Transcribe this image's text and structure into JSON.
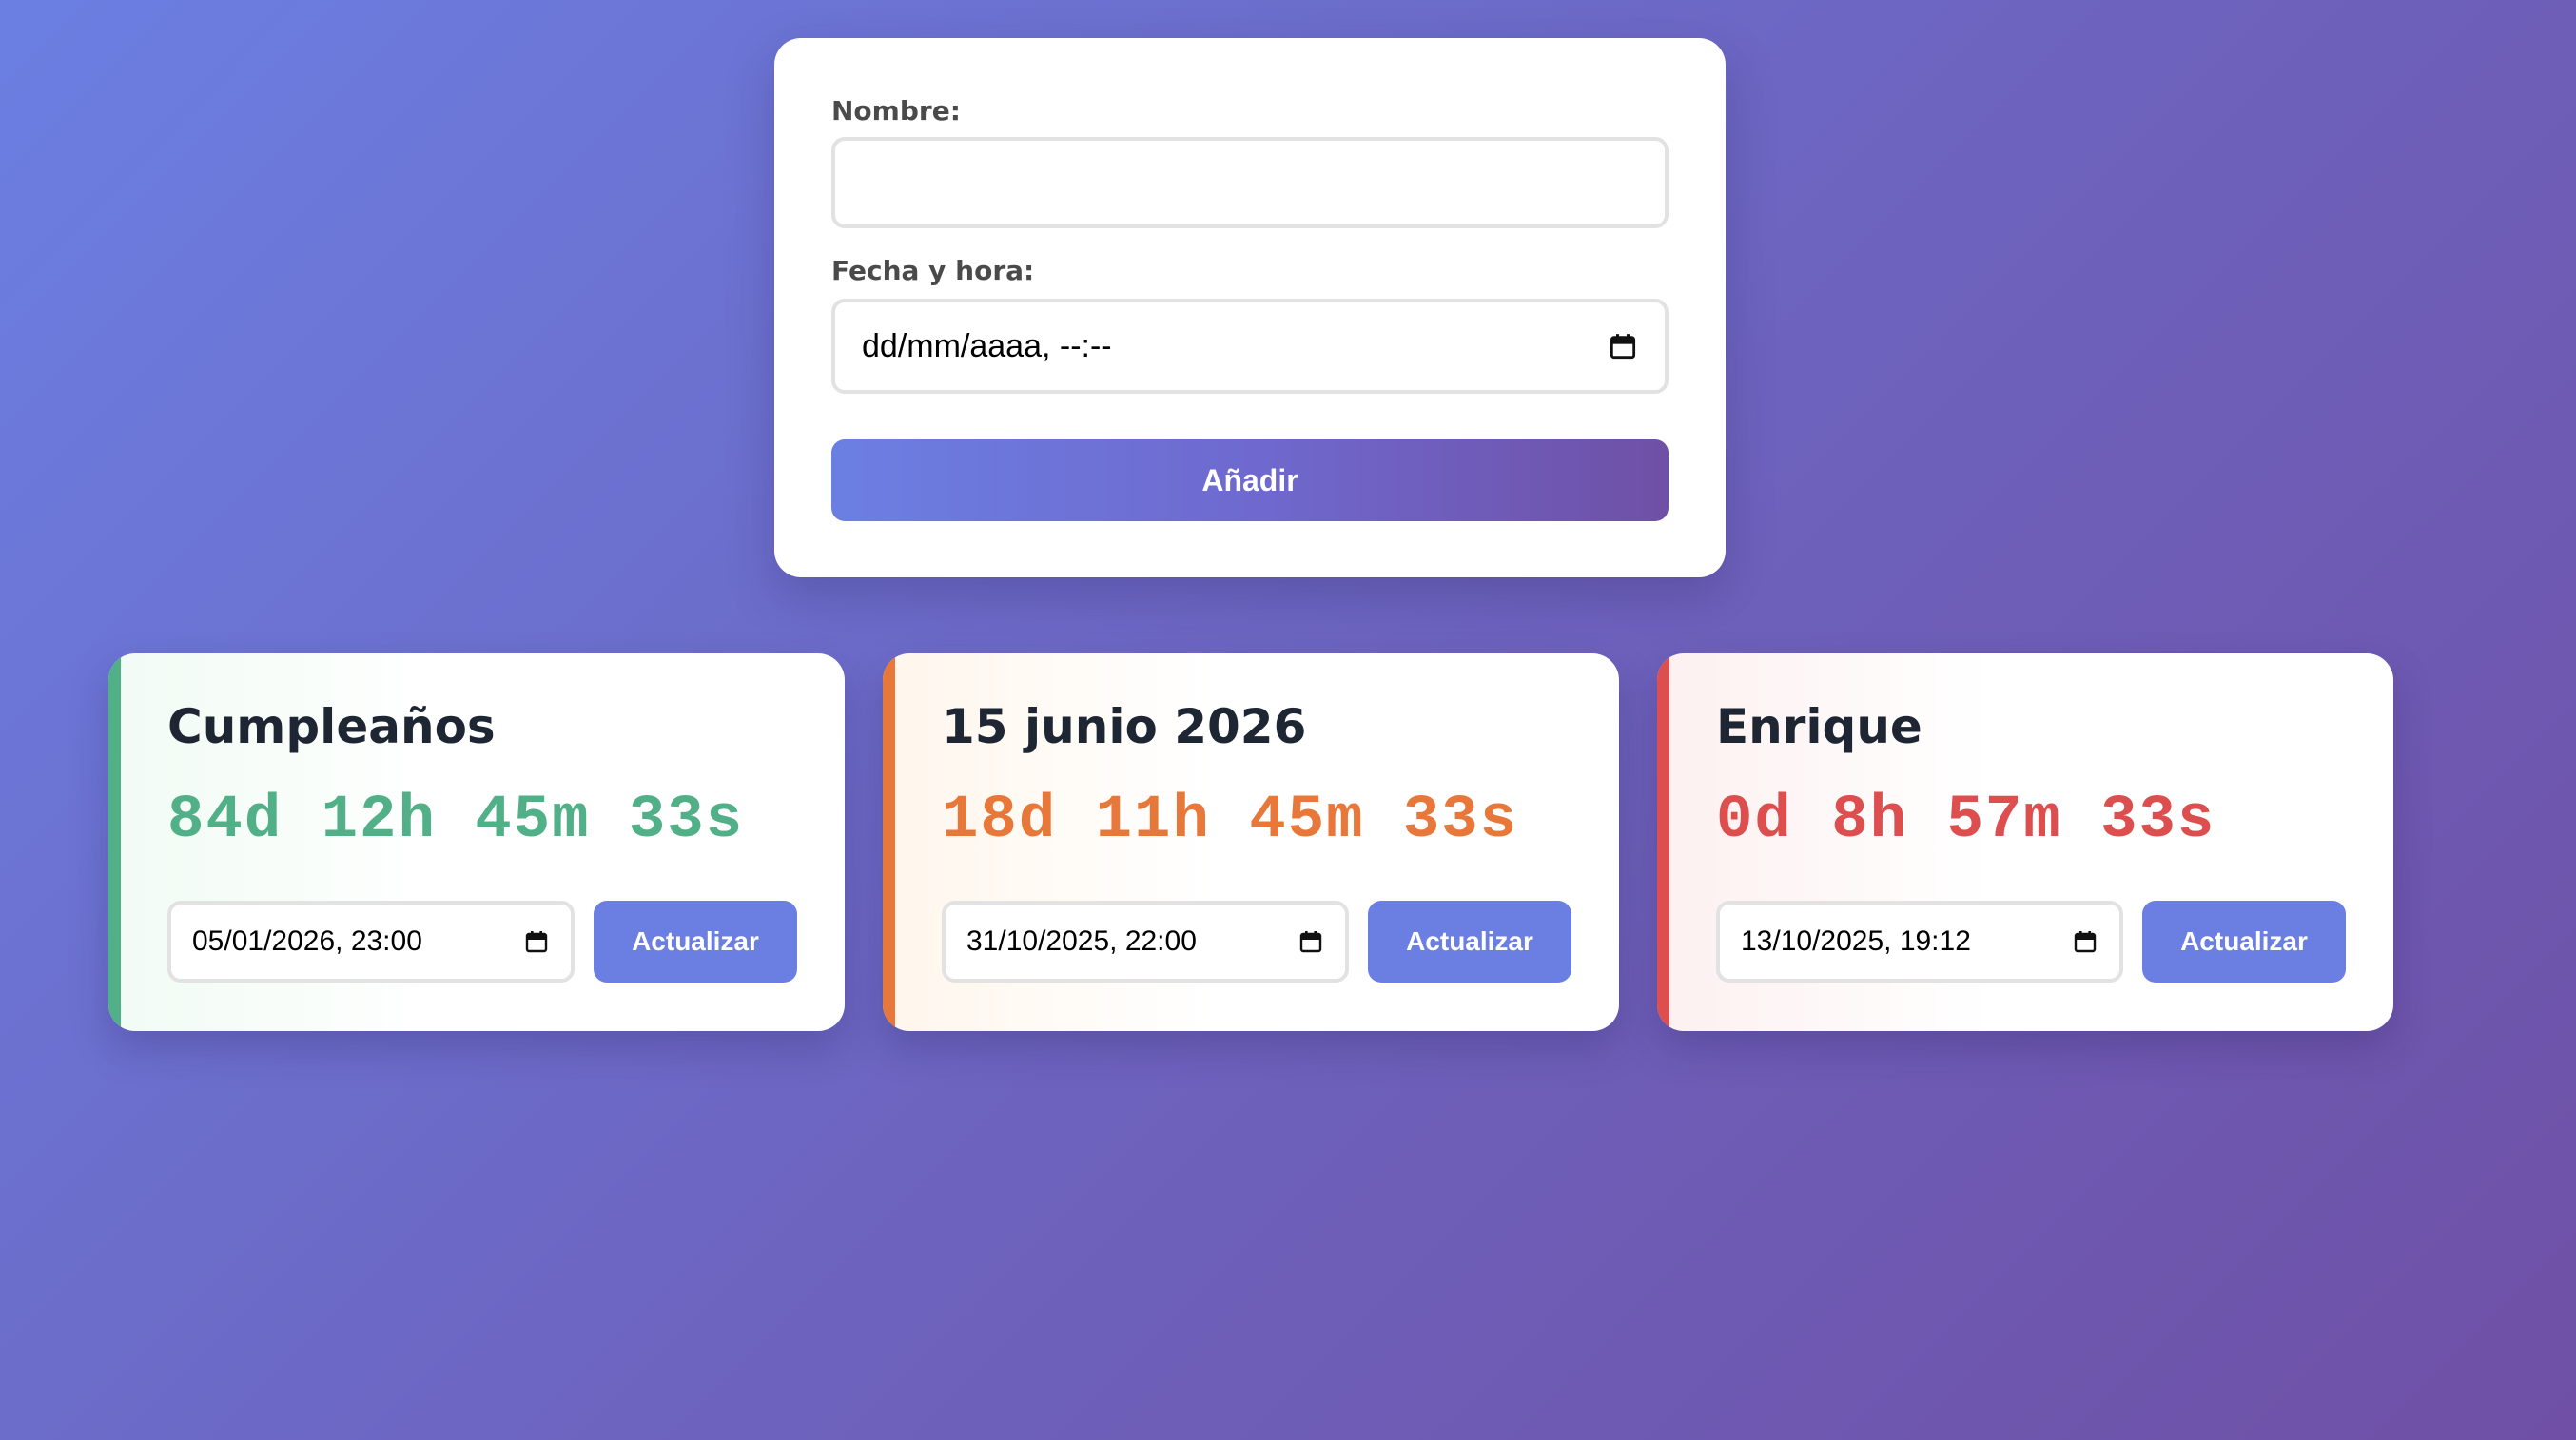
{
  "form": {
    "name_label": "Nombre:",
    "name_value": "",
    "date_label": "Fecha y hora:",
    "date_placeholder": "dd/mm/aaaa, --:--",
    "add_label": "Añadir"
  },
  "cards": [
    {
      "title": "Cumpleaños",
      "countdown": "84d 12h 45m 33s",
      "date": "05/01/2026, 23:00",
      "update_label": "Actualizar",
      "color": "#52b088",
      "tint": "#f1fbf4"
    },
    {
      "title": "15 junio 2026",
      "countdown": "18d 11h 45m 33s",
      "date": "31/10/2025, 22:00",
      "update_label": "Actualizar",
      "color": "#e8783a",
      "tint": "#fff6ec"
    },
    {
      "title": "Enrique",
      "countdown": "0d 8h 57m 33s",
      "date": "13/10/2025, 19:12",
      "update_label": "Actualizar",
      "color": "#dd4e4e",
      "tint": "#fdf0f0"
    }
  ],
  "colors": {
    "accent": "#6b7fe2",
    "gradient_end": "#6f50a6"
  }
}
